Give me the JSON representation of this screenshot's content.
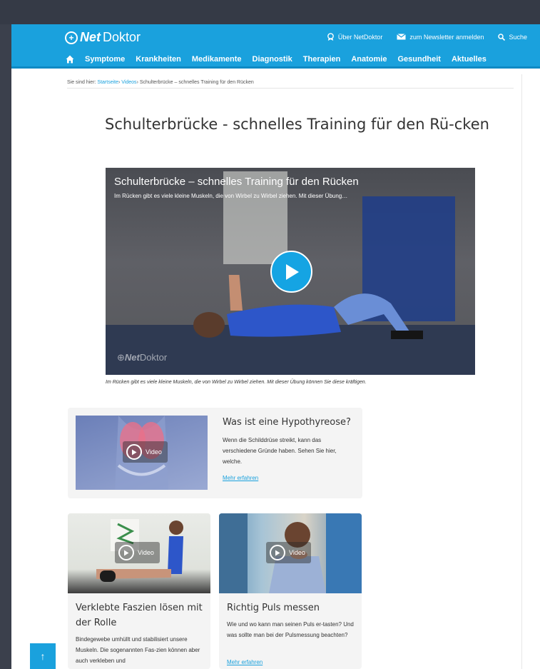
{
  "header": {
    "logo_bold": "Net",
    "logo_rest": "Doktor",
    "links": [
      {
        "label": "Über NetDoktor",
        "icon": "award-icon"
      },
      {
        "label": "zum Newsletter anmelden",
        "icon": "mail-icon"
      },
      {
        "label": "Suche",
        "icon": "search-icon"
      }
    ],
    "nav": [
      "Symptome",
      "Krankheiten",
      "Medikamente",
      "Diagnostik",
      "Therapien",
      "Anatomie",
      "Gesundheit",
      "Aktuelles"
    ]
  },
  "breadcrumb": {
    "prefix": "Sie sind hier:",
    "home": "Startseite",
    "section": "Videos",
    "current": "Schulterbrücke – schnelles Training für den Rücken"
  },
  "article": {
    "title": "Schulterbrücke - schnelles Training für den Rü-cken",
    "video_title": "Schulterbrücke – schnelles Training für den Rücken",
    "video_subtitle": "Im Rücken gibt es viele kleine Muskeln, die von Wirbel zu Wirbel ziehen. Mit dieser Übung…",
    "video_logo_bold": "Net",
    "video_logo_rest": "Doktor",
    "caption": "Im Rücken gibt es viele kleine Muskeln, die von Wirbel zu Wirbel ziehen. Mit dieser Übung können Sie diese kräftigen."
  },
  "cards": [
    {
      "title": "Was ist eine Hypothyreose?",
      "text": "Wenn die Schilddrüse streikt, kann das verschiedene Gründe haben. Sehen Sie hier, welche.",
      "link": "Mehr erfahren",
      "badge": "Video"
    },
    {
      "title": "Verklebte Faszien lösen mit der Rolle",
      "text": "Bindegewebe umhüllt und stabilisiert unsere Muskeln. Die sogenannten Fas-zien können aber auch verkleben und",
      "badge": "Video"
    },
    {
      "title": "Richtig Puls messen",
      "text": "Wie und wo kann man seinen Puls er-tasten? Und was sollte man bei der Pulsmessung beachten?",
      "link": "Mehr erfahren",
      "badge": "Video"
    }
  ],
  "back_to_top": "↑",
  "colors": {
    "brand": "#1aa1dd",
    "frame": "#3a3f4b"
  }
}
